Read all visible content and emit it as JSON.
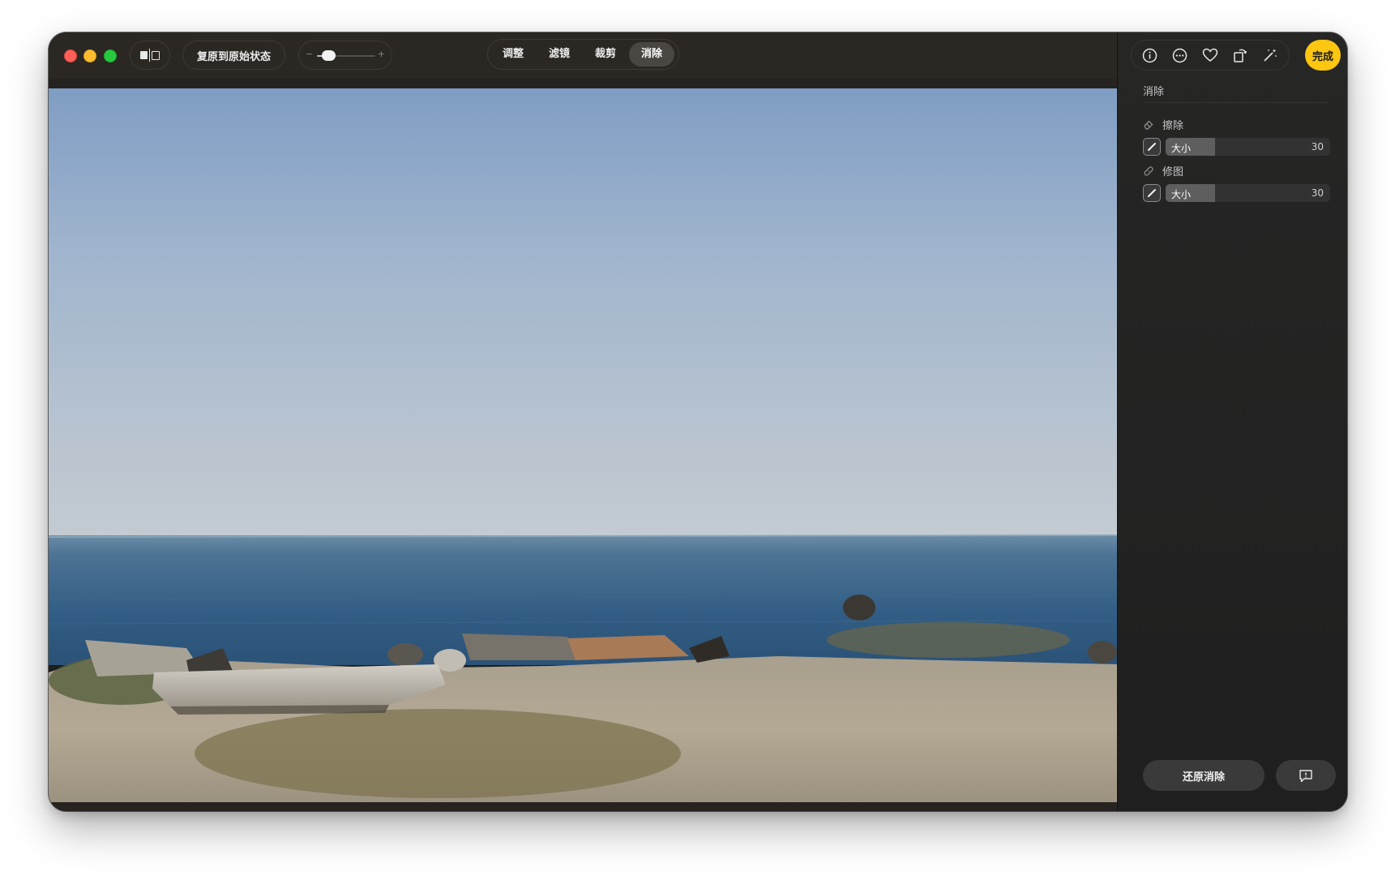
{
  "toolbar": {
    "revert_label": "复原到原始状态",
    "zoom_minus": "−",
    "zoom_plus": "+",
    "zoom_level": 0.1,
    "tabs": [
      {
        "label": "调整",
        "active": false
      },
      {
        "label": "滤镜",
        "active": false
      },
      {
        "label": "裁剪",
        "active": false
      },
      {
        "label": "消除",
        "active": true
      }
    ]
  },
  "panel": {
    "icons": [
      "info-icon",
      "more-icon",
      "heart-icon",
      "rotate-icon",
      "magic-wand-icon"
    ],
    "done_label": "完成",
    "done_color": "#fdc610",
    "title": "消除",
    "erase": {
      "label": "擦除",
      "size_label": "大小",
      "size_value": "30",
      "size_fraction": 0.3
    },
    "retouch": {
      "label": "修图",
      "size_label": "大小",
      "size_value": "30",
      "size_fraction": 0.3
    },
    "revert_erase_label": "还原消除"
  }
}
